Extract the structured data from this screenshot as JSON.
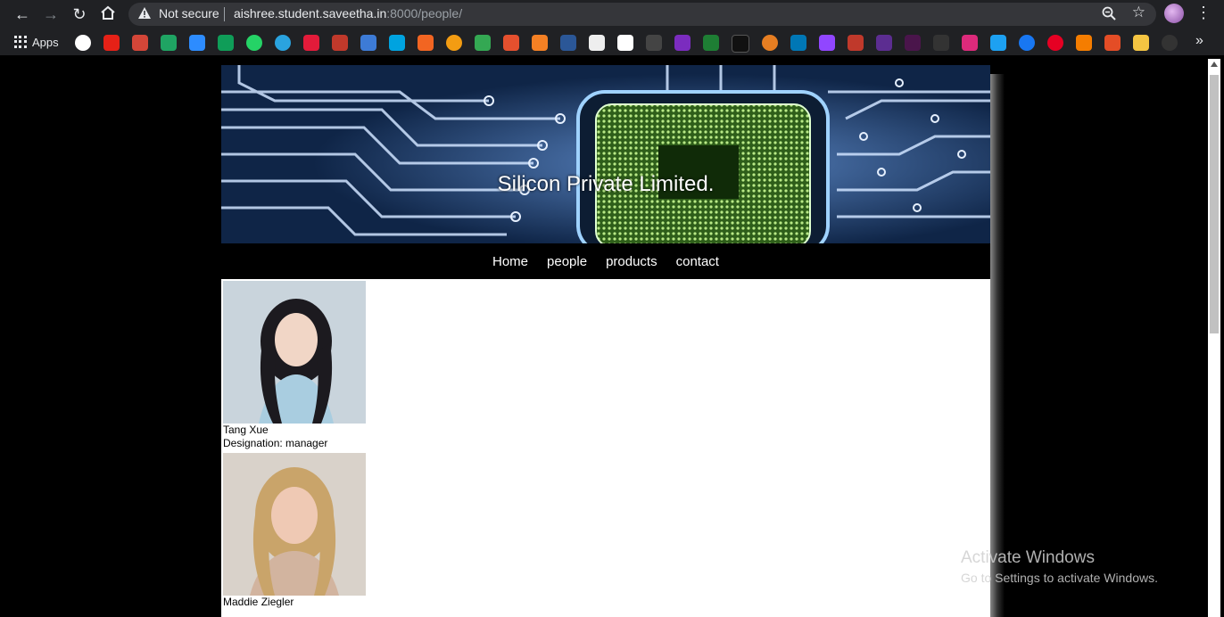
{
  "browser": {
    "url_host": "aishree.student.saveetha.in",
    "url_path": ":8000/people/",
    "security_text": "Not secure",
    "bookmarks_apps_label": "Apps"
  },
  "site": {
    "title": "Silicon Private Limited.",
    "nav": [
      "Home",
      "people",
      "products",
      "contact"
    ]
  },
  "people": [
    {
      "name": "Tang Xue",
      "designation": "Designation: manager"
    },
    {
      "name": "Maddie Ziegler"
    }
  ],
  "watermark": {
    "line1": "Activate Windows",
    "line2": "Go to Settings to activate Windows."
  }
}
